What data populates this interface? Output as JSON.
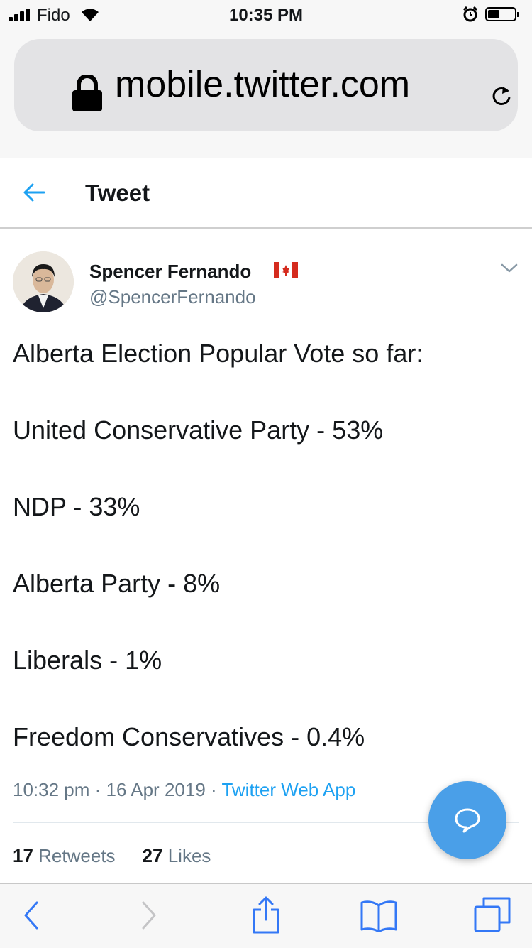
{
  "status_bar": {
    "carrier": "Fido",
    "time": "10:35 PM",
    "battery_level": 0.45
  },
  "browser": {
    "url": "mobile.twitter.com"
  },
  "header": {
    "title": "Tweet"
  },
  "author": {
    "name": "Spencer Fernando",
    "handle": "@SpencerFernando",
    "flag_icon": "canada-flag-icon"
  },
  "tweet": {
    "lines": [
      "Alberta Election Popular Vote so far:",
      "United Conservative Party - 53%",
      "NDP - 33%",
      "Alberta Party - 8%",
      "Liberals - 1%",
      "Freedom Conservatives - 0.4%"
    ],
    "time": "10:32 pm",
    "date": "16 Apr 2019",
    "separator": "·",
    "source": "Twitter Web App"
  },
  "stats": {
    "retweets_count": "17",
    "retweets_label": "Retweets",
    "likes_count": "27",
    "likes_label": "Likes"
  },
  "colors": {
    "accent": "#1da1f2",
    "fab": "#4a9fe8",
    "safari_blue": "#3478f6",
    "secondary_text": "#657786"
  }
}
